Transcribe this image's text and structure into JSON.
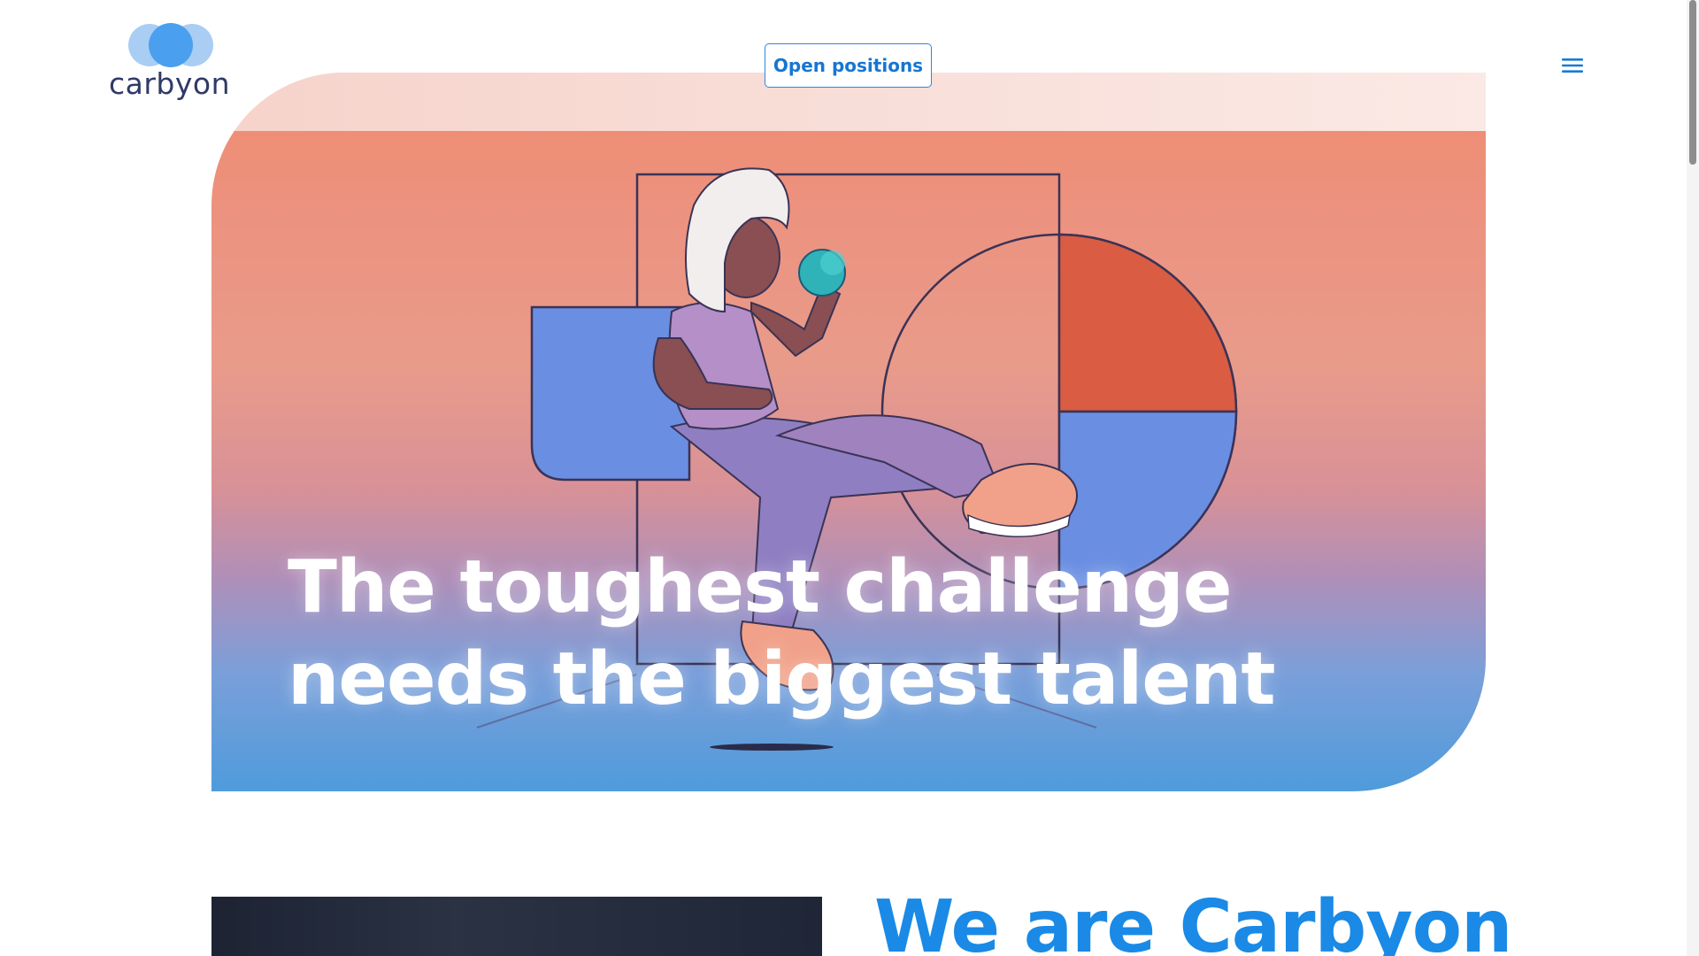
{
  "header": {
    "logo_text": "carbyon",
    "open_positions_label": "Open positions",
    "menu_icon": "hamburger-menu-icon"
  },
  "hero": {
    "headline_line1": "The toughest challenge",
    "headline_line2": "needs the biggest talent",
    "illustration": "woman-sitting-holding-globe-illustration"
  },
  "about": {
    "title": "We are Carbyon"
  },
  "colors": {
    "accent": "#1a8ae6",
    "logo_text": "#2f3a68",
    "hero_salmon": "#ec9381",
    "hero_blue": "#4f9bdb",
    "illustration_blue": "#6a8ee2",
    "illustration_red": "#d95c43"
  }
}
